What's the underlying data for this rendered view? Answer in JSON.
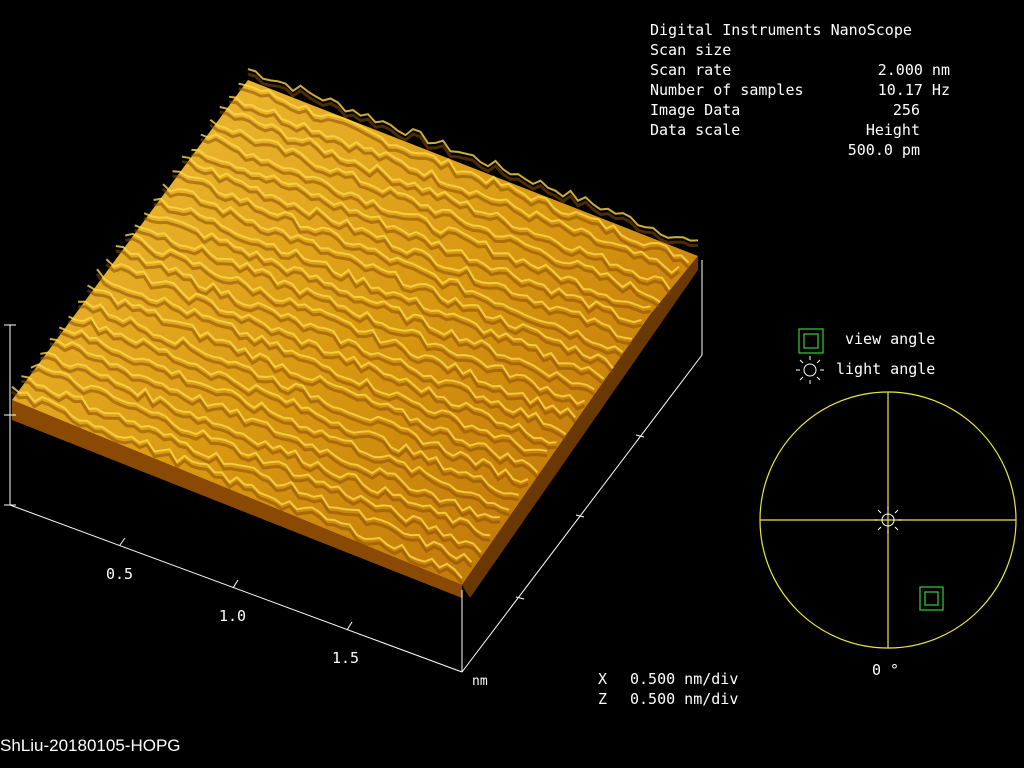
{
  "info": {
    "title": "Digital Instruments NanoScope",
    "rows": [
      {
        "key": "Scan size",
        "value": "2.000 nm"
      },
      {
        "key": "Scan rate",
        "value": "10.17 Hz"
      },
      {
        "key": "Number of samples",
        "value": "256"
      },
      {
        "key": "Image Data",
        "value": "Height"
      },
      {
        "key": "Data scale",
        "value": "500.0 pm"
      }
    ]
  },
  "axes": {
    "ticks": [
      "0.5",
      "1.0",
      "1.5"
    ],
    "unit": "nm",
    "scales": [
      {
        "axis": "X",
        "value": "0.500 nm/div"
      },
      {
        "axis": "Z",
        "value": "0.500 nm/div"
      }
    ]
  },
  "legend": {
    "view_label": "view angle",
    "light_label": "light angle",
    "angle_readout": "0 °",
    "view_icon": "square-icon",
    "light_icon": "sun-icon"
  },
  "filename": "ShLiu-20180105-HOPG",
  "colors": {
    "surface_high": "#f0c030",
    "surface_low": "#7a3a00",
    "axis": "#ffffff",
    "dial": "#ffff40",
    "marker": "#20c040"
  }
}
